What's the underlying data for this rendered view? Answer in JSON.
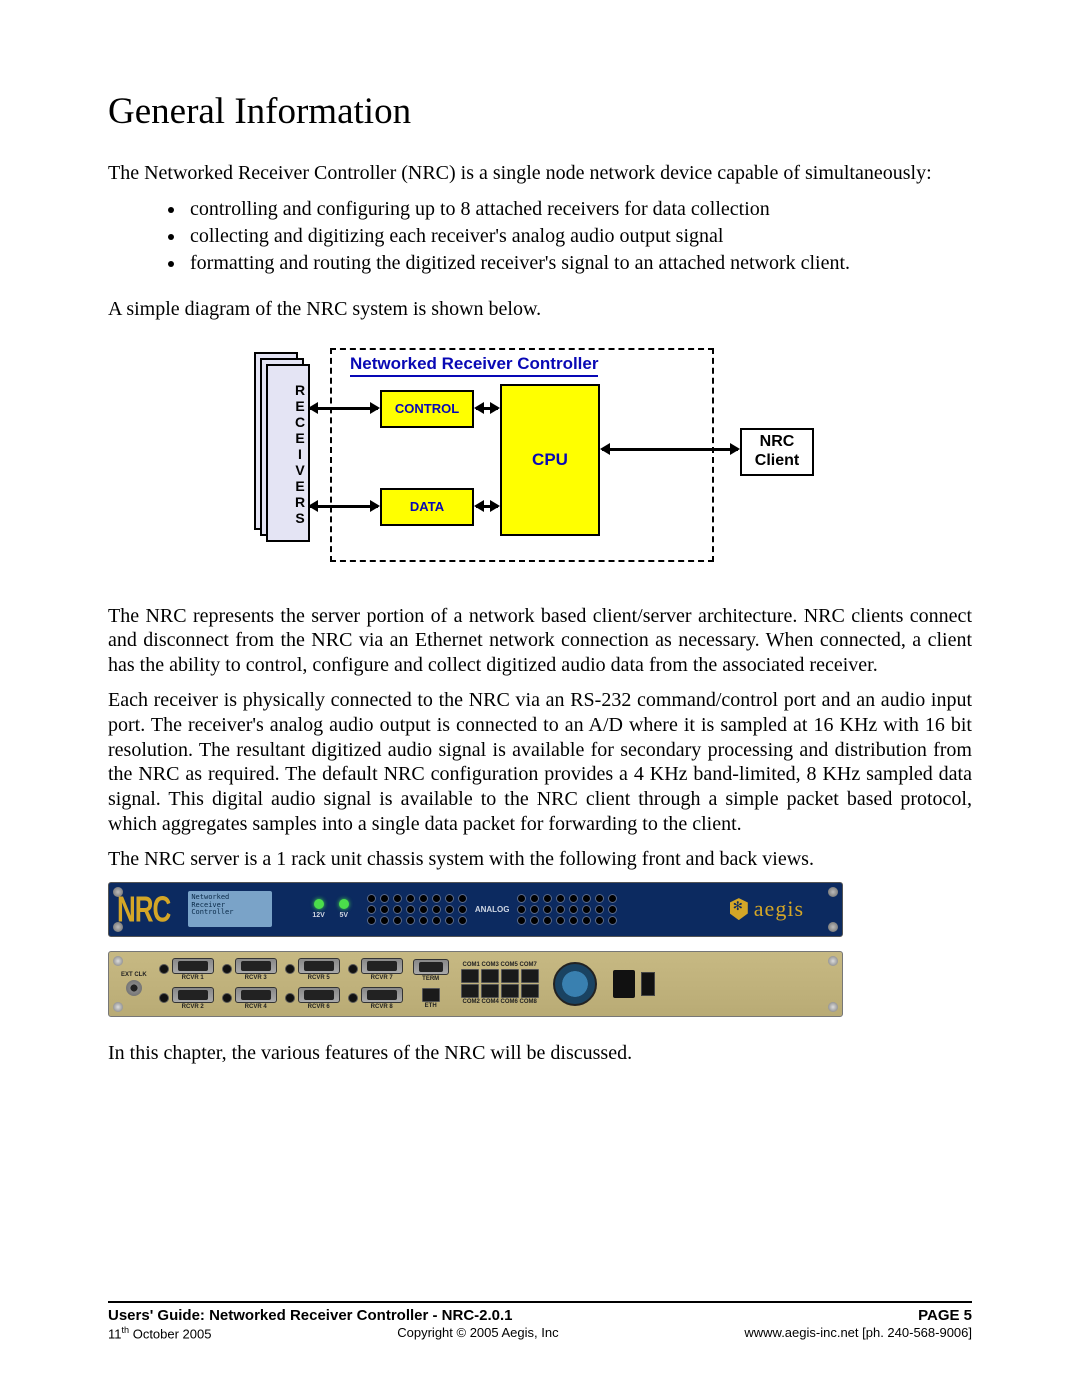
{
  "title": "General Information",
  "intro": "The Networked Receiver Controller (NRC) is a single node network device capable of simultaneously:",
  "bullets": [
    "controlling and configuring up to 8 attached receivers for data collection",
    "collecting and digitizing each receiver's analog audio output signal",
    "formatting and routing the digitized receiver's signal to an attached network client."
  ],
  "diagram_intro": "A simple diagram of the NRC system is shown below.",
  "diagram": {
    "box_title": "Networked Receiver Controller",
    "receivers_label": "RECEIVERS",
    "control": "CONTROL",
    "data": "DATA",
    "cpu": "CPU",
    "client_l1": "NRC",
    "client_l2": "Client"
  },
  "para2": "The NRC represents the server portion of a network based client/server architecture. NRC clients connect and disconnect from the NRC via an Ethernet network connection as necessary. When connected, a client has the ability to control, configure and collect digitized audio data from the associated receiver.",
  "para3": "Each receiver is physically connected to the NRC via an RS-232 command/control port and an audio input port. The receiver's analog audio output is connected to an A/D where it is sampled at 16 KHz with 16 bit resolution. The resultant digitized audio signal is available for secondary processing and distribution from the NRC as required. The default NRC configuration provides a 4 KHz band-limited, 8 KHz sampled data signal. This digital audio signal is available to the NRC client through a simple packet based protocol, which aggregates samples into a single data packet for forwarding to the client.",
  "para4": "The NRC server is a 1 rack unit chassis system with the following front and back views.",
  "front": {
    "logo": "NRC",
    "lcd_l1": "Networked",
    "lcd_l2": "Receiver",
    "lcd_l3": "Controller",
    "led1": "12V",
    "led2": "5V",
    "analog": "ANALOG",
    "brand": "aegis"
  },
  "back": {
    "ext_clk": "EXT CLK",
    "rcvr": [
      "RCVR 1",
      "RCVR 2",
      "RCVR 3",
      "RCVR 4",
      "RCVR 5",
      "RCVR 6",
      "RCVR 7",
      "RCVR 8"
    ],
    "term": "TERM",
    "eth": "ETH",
    "com_top": "COM1 COM3 COM5 COM7",
    "com_bot": "COM2 COM4 COM6 COM8"
  },
  "closing": "In this chapter, the various features of the NRC will be discussed.",
  "footer": {
    "left_bold": "Users' Guide: Networked Receiver Controller - NRC-2.0.1",
    "right_bold": "PAGE 5",
    "date_pre": "11",
    "date_post": " October 2005",
    "copyright": "Copyright © 2005 Aegis, Inc",
    "contact": "wwww.aegis-inc.net [ph. 240-568-9006]"
  }
}
